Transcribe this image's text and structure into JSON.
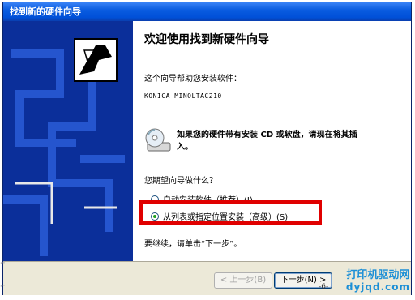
{
  "window": {
    "title": "找到新的硬件向导"
  },
  "content": {
    "heading": "欢迎使用找到新硬件向导",
    "intro": "这个向导帮助您安装软件：",
    "device": "KONICA MINOLTAC210",
    "notice": "如果您的硬件带有安装 CD 或软盘，请现在将其插入。",
    "question": "您期望向导做什么？",
    "options": [
      {
        "label": "自动安装软件（推荐）(I)",
        "selected": false
      },
      {
        "label": "从列表或指定位置安装（高级）(S)",
        "selected": true
      }
    ],
    "continue_hint": "要继续，请单击“下一步”。"
  },
  "buttons": {
    "back": "< 上一步(B)",
    "next": "下一步(N) >"
  },
  "watermark": {
    "line1": "打印机驱动网",
    "line2": "dyjqd.com"
  },
  "page_number": "-6-",
  "colors": {
    "highlight": "#e00000",
    "titlebar": "#0050d8",
    "sidepanel": "#0b2f9a"
  }
}
